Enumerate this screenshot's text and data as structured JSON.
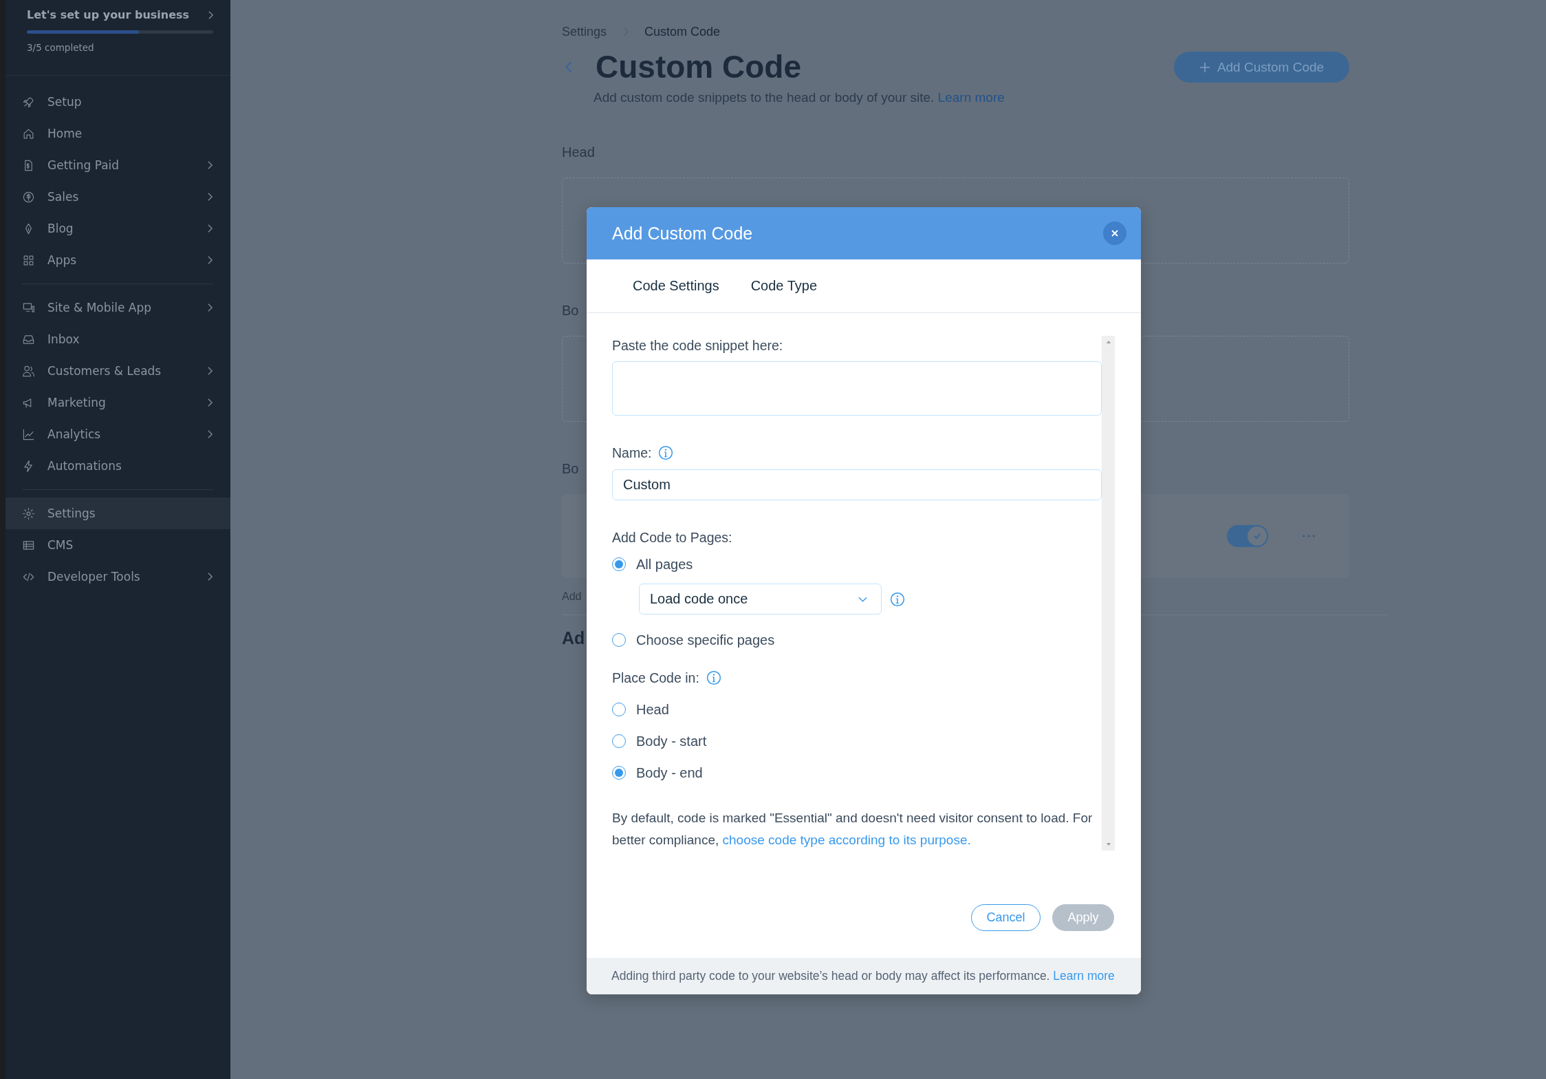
{
  "sidebar": {
    "setup": {
      "title": "Let's set up your business",
      "level": 0.6,
      "progress": "3/5 completed"
    },
    "groups": [
      {
        "items": [
          {
            "label": "Setup",
            "chevron": false,
            "selected": false
          },
          {
            "label": "Home",
            "chevron": false,
            "selected": false
          },
          {
            "label": "Getting Paid",
            "chevron": true,
            "selected": false
          },
          {
            "label": "Sales",
            "chevron": true,
            "selected": false
          },
          {
            "label": "Blog",
            "chevron": true,
            "selected": false
          },
          {
            "label": "Apps",
            "chevron": true,
            "selected": false
          }
        ]
      },
      {
        "items": [
          {
            "label": "Site & Mobile App",
            "chevron": true,
            "selected": false
          },
          {
            "label": "Inbox",
            "chevron": false,
            "selected": false
          },
          {
            "label": "Customers & Leads",
            "chevron": true,
            "selected": false
          },
          {
            "label": "Marketing",
            "chevron": true,
            "selected": false
          },
          {
            "label": "Analytics",
            "chevron": true,
            "selected": false
          },
          {
            "label": "Automations",
            "chevron": false,
            "selected": false
          }
        ]
      },
      {
        "items": [
          {
            "label": "Settings",
            "chevron": false,
            "selected": true
          },
          {
            "label": "CMS",
            "chevron": false,
            "selected": false
          },
          {
            "label": "Developer Tools",
            "chevron": true,
            "selected": false
          }
        ]
      }
    ]
  },
  "breadcrumbs": [
    "Settings",
    "Custom Code"
  ],
  "page": {
    "title": "Custom Code",
    "subtitle": "Add custom code snippets to the head or body of your site.",
    "link": "Learn more",
    "action": "Add Custom Code"
  },
  "background": {
    "head_label": "Head",
    "section_2_label": "Bo",
    "section_3_label": "Bo",
    "toggle_on": true,
    "row_note": "Add",
    "section_4_heading": "Ad"
  },
  "modal": {
    "title": "Add Custom Code",
    "tabs": [
      {
        "label": "Code Settings"
      },
      {
        "label": "Code Type"
      }
    ],
    "snippet_label": "Paste the code snippet here:",
    "name_label": "Name:",
    "name_value": "Custom",
    "pages_label": "Add Code to Pages:",
    "pages_options": [
      {
        "label": "All pages",
        "selected": true,
        "select": "Load code once"
      },
      {
        "label": "Choose specific pages",
        "selected": false
      }
    ],
    "place_label": "Place Code in:",
    "place_options": [
      {
        "label": "Head",
        "selected": false
      },
      {
        "label": "Body - start",
        "selected": false
      },
      {
        "label": "Body - end",
        "selected": true
      }
    ],
    "notice": "By default, code is marked \"Essential\" and doesn't need visitor consent to load. For better compliance, ",
    "notice_link": "choose code type according to its purpose.",
    "cancel": "Cancel",
    "apply": {
      "label": "Apply",
      "disabled": true
    },
    "footer": "Adding third party code to your website’s head or body may affect its performance.",
    "footer_link": "Learn more"
  }
}
